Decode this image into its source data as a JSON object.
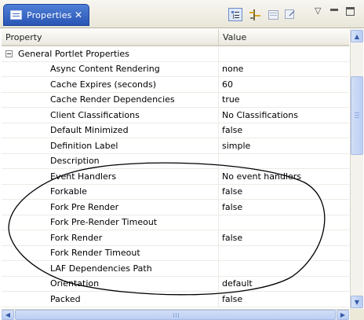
{
  "tab": {
    "title": "Properties",
    "close": "✕",
    "icon": "properties-view-icon"
  },
  "toolbar": {
    "icons": [
      "show-categories-icon",
      "show-advanced-icon",
      "restore-default-icon",
      "filter-icon"
    ],
    "view_menu": "▽"
  },
  "table": {
    "columns": [
      "Property",
      "Value"
    ],
    "group": "General Portlet Properties",
    "rows": [
      {
        "property": "Async Content Rendering",
        "value": "none"
      },
      {
        "property": "Cache Expires (seconds)",
        "value": "60"
      },
      {
        "property": "Cache Render Dependencies",
        "value": "true"
      },
      {
        "property": "Client Classifications",
        "value": "No Classifications"
      },
      {
        "property": "Default Minimized",
        "value": "false"
      },
      {
        "property": "Definition Label",
        "value": "simple"
      },
      {
        "property": "Description",
        "value": ""
      },
      {
        "property": "Event Handlers",
        "value": "No event handlers"
      },
      {
        "property": "Forkable",
        "value": "false"
      },
      {
        "property": "Fork Pre Render",
        "value": "false"
      },
      {
        "property": "Fork Pre-Render Timeout",
        "value": ""
      },
      {
        "property": "Fork Render",
        "value": "false"
      },
      {
        "property": "Fork Render Timeout",
        "value": ""
      },
      {
        "property": "LAF Dependencies Path",
        "value": ""
      },
      {
        "property": "Orientation",
        "value": "default"
      },
      {
        "property": "Packed",
        "value": "false"
      }
    ]
  },
  "scrollbar": {
    "up": "▲",
    "down": "▼",
    "left": "◀",
    "right": "▶"
  },
  "colors": {
    "tab": "#2a56b5",
    "annotation": "#000000"
  }
}
